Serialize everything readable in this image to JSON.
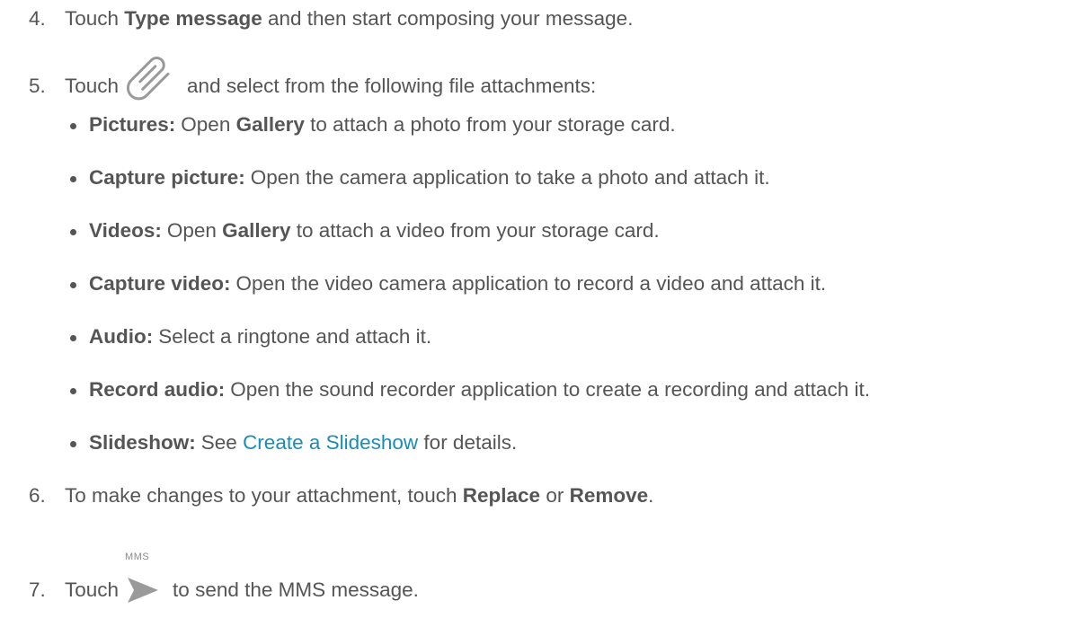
{
  "steps": {
    "s4": {
      "num": "4.",
      "pre": "Touch ",
      "bold": "Type message",
      "post": " and then start composing your message."
    },
    "s5": {
      "num": "5.",
      "pre": "Touch",
      "icon": "paperclip-icon",
      "post": "and select from the following file attachments:"
    },
    "s6": {
      "num": "6.",
      "pre": "To make changes to your attachment, touch ",
      "bold1": "Replace",
      "mid": " or ",
      "bold2": "Remove",
      "post": "."
    },
    "s7": {
      "num": "7.",
      "pre": "Touch",
      "icon": "send-icon",
      "icon_label": "MMS",
      "post": "to send the MMS message."
    }
  },
  "attachments": [
    {
      "label": "Pictures:",
      "pre": "Open ",
      "bold": "Gallery",
      "post": " to attach a photo from your storage card."
    },
    {
      "label": "Capture picture:",
      "text": "Open the camera application to take a photo and attach it."
    },
    {
      "label": "Videos:",
      "pre": "Open ",
      "bold": "Gallery",
      "post": " to attach a video from your storage card."
    },
    {
      "label": "Capture video:",
      "text": "Open the video camera application to record a video and attach it."
    },
    {
      "label": "Audio:",
      "text": "Select a ringtone and attach it."
    },
    {
      "label": "Record audio:",
      "text": "Open the sound recorder application to create a recording and attach it."
    },
    {
      "label": "Slideshow:",
      "pre": "See ",
      "link": "Create a Slideshow",
      "post": " for details."
    }
  ],
  "colors": {
    "text": "#555555",
    "link": "#1a8cb6",
    "icon": "#9a9a9a"
  }
}
